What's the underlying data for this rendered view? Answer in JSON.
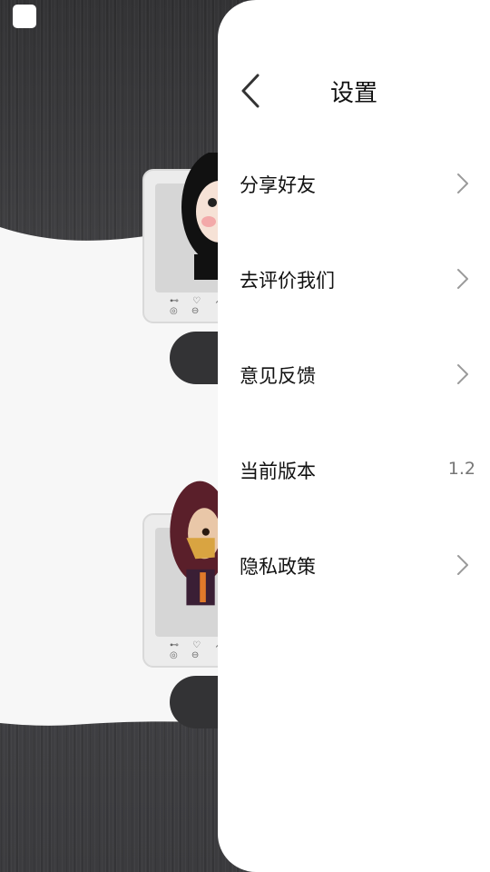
{
  "drawer": {
    "title": "设置",
    "items": [
      {
        "label": "分享好友",
        "icon": "chevron-right-icon"
      },
      {
        "label": "去评价我们",
        "icon": "chevron-right-icon"
      },
      {
        "label": "意见反馈",
        "icon": "chevron-right-icon"
      },
      {
        "label": "当前版本",
        "value": "1.2"
      },
      {
        "label": "隐私政策",
        "icon": "chevron-right-icon"
      }
    ]
  },
  "background": {
    "cards": [
      {
        "icons": "⊷ ♡ ↗ ◎ ⊖"
      },
      {
        "icons": "⊷ ♡ ↗ ◎ ⊖"
      }
    ]
  },
  "colors": {
    "drawer_bg": "#ffffff",
    "backdrop": "#3a3a3c",
    "text_primary": "#111111",
    "text_secondary": "#777777",
    "chevron": "#9a9a9a"
  }
}
